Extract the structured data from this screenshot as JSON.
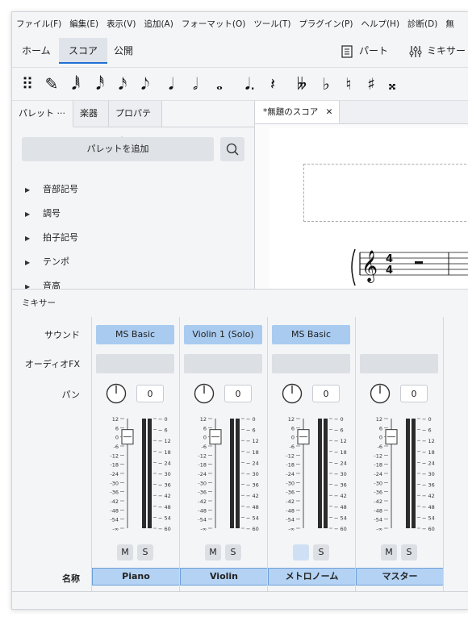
{
  "menu": [
    "ファイル(F)",
    "編集(E)",
    "表示(V)",
    "追加(A)",
    "フォーマット(O)",
    "ツール(T)",
    "プラグイン(P)",
    "ヘルプ(H)",
    "診断(D)",
    "無"
  ],
  "tabs": {
    "home": "ホーム",
    "score": "スコア",
    "publish": "公開"
  },
  "right_buttons": {
    "parts": "パート",
    "mixer": "ミキサー"
  },
  "note_toolbar": [
    "⠿",
    "✎",
    "𝅘𝅥𝅱",
    "𝅘𝅥𝅰",
    "𝅘𝅥𝅯",
    "𝅘𝅥𝅮",
    "𝅘𝅥",
    "𝅗𝅥",
    "𝅝",
    "𝅘𝅥.",
    "𝄽",
    "𝄫",
    "♭",
    "♮",
    "♯",
    "𝄪"
  ],
  "palette": {
    "tabs": {
      "palette": "パレット ···",
      "instruments": "楽器",
      "properties": "プロパティ"
    },
    "add_button": "パレットを追加",
    "items": [
      "音部記号",
      "調号",
      "拍子記号",
      "テンポ",
      "音高"
    ]
  },
  "score": {
    "tab_title": "*無題のスコア",
    "close": "✕"
  },
  "mixer": {
    "title": "ミキサー",
    "row_labels": {
      "sound": "サウンド",
      "audio_fx": "オーディオFX",
      "pan": "パン",
      "name": "名称"
    },
    "scale_left": [
      "12",
      "6",
      "0",
      "-6",
      "-12",
      "-18",
      "-24",
      "-30",
      "-36",
      "-42",
      "-48",
      "-54",
      "-∞"
    ],
    "scale_right": [
      "0",
      "6",
      "12",
      "18",
      "24",
      "30",
      "36",
      "42",
      "48",
      "54",
      "60"
    ],
    "mute_label": "M",
    "solo_label": "S",
    "channels": [
      {
        "name": "Piano",
        "sound": "MS Basic",
        "pan": "0",
        "mute_dim": false
      },
      {
        "name": "Violin",
        "sound": "Violin 1 (Solo)",
        "pan": "0",
        "mute_dim": false
      },
      {
        "name": "メトロノーム",
        "sound": "MS Basic",
        "pan": "0",
        "mute_dim": true
      },
      {
        "name": "マスター",
        "sound": "",
        "pan": "0",
        "mute_dim": false
      }
    ]
  }
}
